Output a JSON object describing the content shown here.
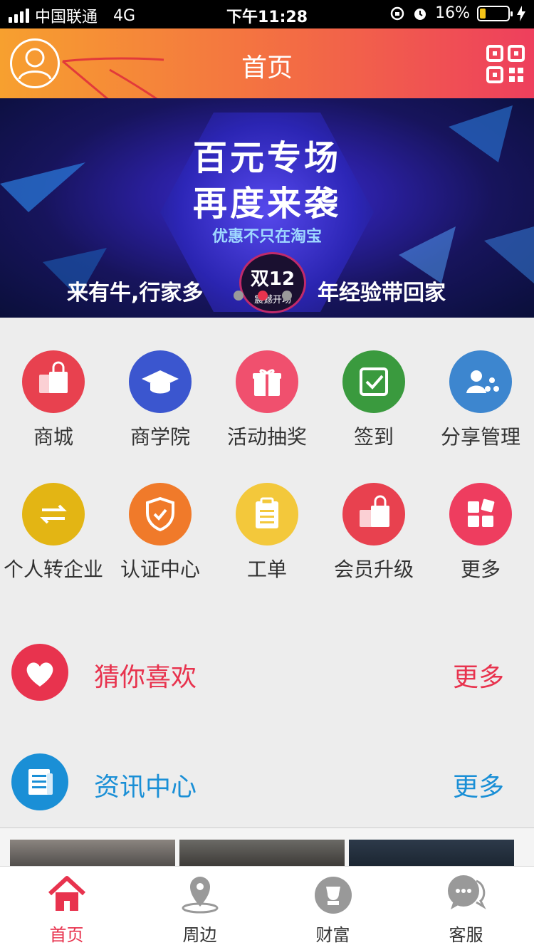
{
  "status_bar": {
    "carrier": "中国联通",
    "network": "4G",
    "time": "下午11:28",
    "battery": "16%"
  },
  "header": {
    "title": "首页",
    "avatar_icon": "user-avatar-icon",
    "qr_icon": "qr-code-icon",
    "gradient": [
      "#f7a02f",
      "#ee3f5d"
    ]
  },
  "banner": {
    "line1": "百元专场",
    "line2": "再度来袭",
    "line3": "优惠不只在淘宝",
    "slogan_left": "来有牛,行家多",
    "slogan_right": "年经验带回家",
    "badge_title": "双12",
    "badge_sub": "震撼开场",
    "slide_count": 3,
    "active_slide": 2
  },
  "grid": [
    {
      "label": "商城",
      "icon": "shopping-bag-icon",
      "color": "#e8414f"
    },
    {
      "label": "商学院",
      "icon": "graduation-cap-icon",
      "color": "#3b56cf"
    },
    {
      "label": "活动抽奖",
      "icon": "gift-icon",
      "color": "#f0506e"
    },
    {
      "label": "签到",
      "icon": "checkbox-icon",
      "color": "#3a9a3e"
    },
    {
      "label": "分享管理",
      "icon": "share-user-icon",
      "color": "#3d86cf"
    },
    {
      "label": "个人转企业",
      "icon": "transfer-arrows-icon",
      "color": "#e3b514"
    },
    {
      "label": "认证中心",
      "icon": "shield-check-icon",
      "color": "#f07a2a"
    },
    {
      "label": "工单",
      "icon": "clipboard-icon",
      "color": "#f3c83b"
    },
    {
      "label": "会员升级",
      "icon": "shopping-bags-icon",
      "color": "#e8414f"
    },
    {
      "label": "更多",
      "icon": "grid-more-icon",
      "color": "#ee3d5f"
    }
  ],
  "sections": [
    {
      "title": "猜你喜欢",
      "more": "更多",
      "icon": "heart-icon",
      "color": "#e8334e"
    },
    {
      "title": "资讯中心",
      "more": "更多",
      "icon": "news-icon",
      "color": "#1a8fd6"
    }
  ],
  "tabs": [
    {
      "label": "首页",
      "icon": "home-icon",
      "active": true
    },
    {
      "label": "周边",
      "icon": "location-pin-icon",
      "active": false
    },
    {
      "label": "财富",
      "icon": "wealth-icon",
      "active": false
    },
    {
      "label": "客服",
      "icon": "chat-bubble-icon",
      "active": false
    }
  ],
  "colors": {
    "accent": "#e8334e",
    "link_blue": "#1a8fd6",
    "background": "#ededed"
  }
}
